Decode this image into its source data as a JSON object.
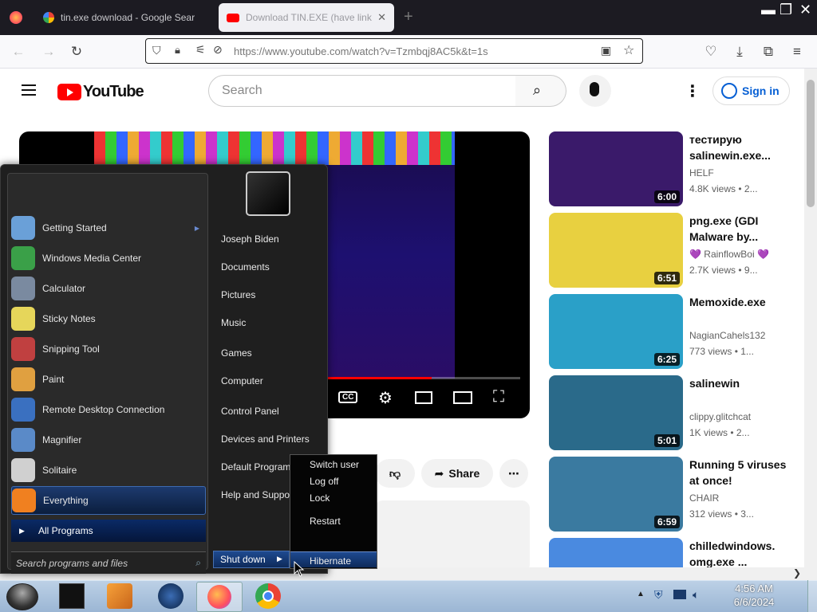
{
  "browser": {
    "tabs": [
      {
        "title": "tin.exe download - Google Sear"
      },
      {
        "title": "Download TIN.EXE (have link in"
      }
    ],
    "url": "https://www.youtube.com/watch?v=Tzmbqj8AC5k&t=1s"
  },
  "youtube": {
    "logo_text": "YouTube",
    "search_placeholder": "Search",
    "sign_in": "Sign in",
    "actions": {
      "share": "Share"
    },
    "recommendations": [
      {
        "title": "тестирую salinewin.exe...",
        "channel": "HELF",
        "meta": "4.8K views • 2...",
        "duration": "6:00",
        "color": "#3a1a6a"
      },
      {
        "title": "png.exe (GDI Malware by...",
        "channel": "💜 RainflowBoi 💜",
        "meta": "2.7K views • 9...",
        "duration": "6:51",
        "color": "#e8d040"
      },
      {
        "title": "Memoxide.exe",
        "channel": "NagianCahels132",
        "meta": "773 views • 1...",
        "duration": "6:25",
        "color": "#2aa0c8"
      },
      {
        "title": "salinewin",
        "channel": "clippy.glitchcat",
        "meta": "1K views • 2...",
        "duration": "5:01",
        "color": "#2a6a8a"
      },
      {
        "title": "Running 5 viruses at once!",
        "channel": "CHAIR",
        "meta": "312 views • 3...",
        "duration": "6:59",
        "color": "#3a7aa0"
      },
      {
        "title": "chilledwindows. omg.exe ...",
        "channel": "",
        "meta": "",
        "duration": "",
        "color": "#4a8ae0"
      }
    ]
  },
  "startmenu": {
    "programs": [
      {
        "label": "Getting Started",
        "color": "#6aa0d8"
      },
      {
        "label": "Windows Media Center",
        "color": "#3aa048"
      },
      {
        "label": "Calculator",
        "color": "#7a8aa0"
      },
      {
        "label": "Sticky Notes",
        "color": "#e6d65a"
      },
      {
        "label": "Snipping Tool",
        "color": "#c04040"
      },
      {
        "label": "Paint",
        "color": "#e0a040"
      },
      {
        "label": "Remote Desktop Connection",
        "color": "#3a70c0"
      },
      {
        "label": "Magnifier",
        "color": "#5a8ac8"
      },
      {
        "label": "Solitaire",
        "color": "#d0d0d0"
      },
      {
        "label": "Everything",
        "color": "#f08020"
      }
    ],
    "all_programs": "All Programs",
    "search_placeholder": "Search programs and files",
    "right_links": [
      "Joseph Biden",
      "Documents",
      "Pictures",
      "Music",
      "Games",
      "Computer",
      "Control Panel",
      "Devices and Printers",
      "Default Programs",
      "Help and Support"
    ],
    "shutdown": "Shut down",
    "shutdown_submenu": [
      "Switch user",
      "Log off",
      "Lock",
      "Restart",
      "Hibernate"
    ]
  },
  "taskbar": {
    "time": "4:56 AM",
    "date": "6/6/2024"
  }
}
